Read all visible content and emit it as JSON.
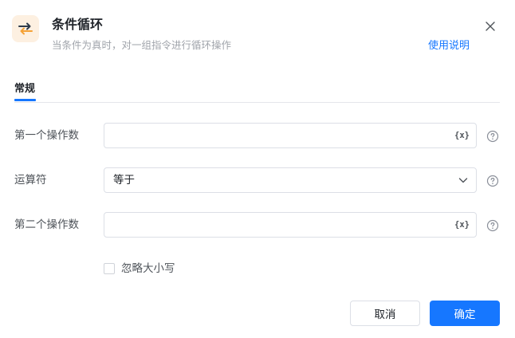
{
  "dialog": {
    "title": "条件循环",
    "subtitle": "当条件为真时，对一组指令进行循环操作",
    "help_link": "使用说明",
    "icon": "loop-icon",
    "close_icon": "close-icon"
  },
  "tabs": [
    {
      "label": "常规",
      "active": true
    }
  ],
  "fields": {
    "operand1": {
      "label": "第一个操作数",
      "value": "",
      "variable_button": "{x}"
    },
    "operator": {
      "label": "运算符",
      "selected": "等于"
    },
    "operand2": {
      "label": "第二个操作数",
      "value": "",
      "variable_button": "{x}"
    }
  },
  "options": {
    "ignore_case": {
      "label": "忽略大小写",
      "checked": false
    }
  },
  "buttons": {
    "cancel": "取消",
    "ok": "确定"
  },
  "colors": {
    "accent": "#1677ff",
    "icon_bg": "#fdf0e1",
    "icon_orange": "#f5a236",
    "icon_dark": "#2d3a4a"
  }
}
